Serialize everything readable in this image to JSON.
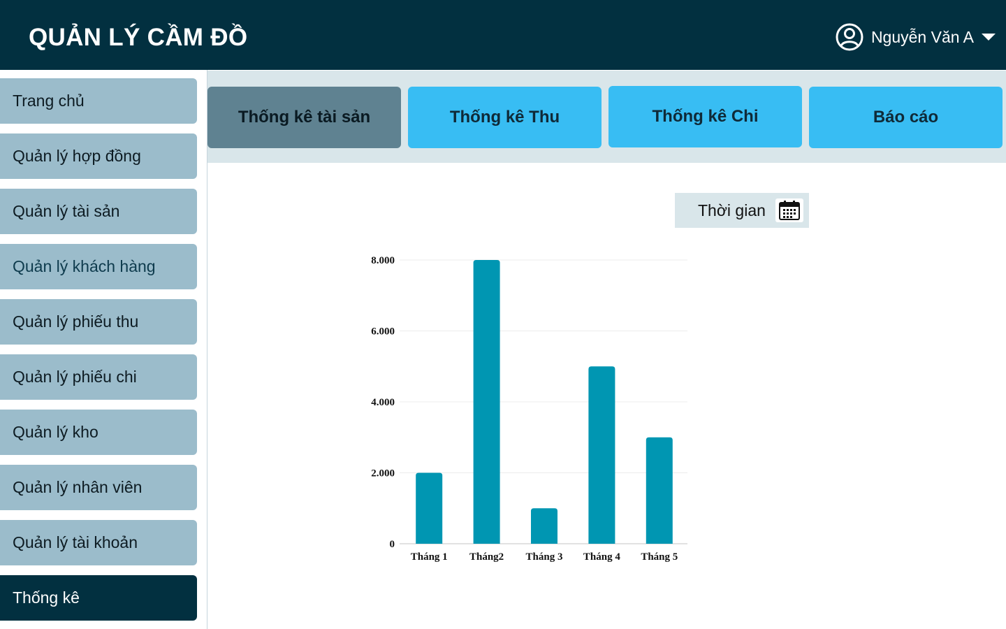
{
  "header": {
    "app_title": "QUẢN LÝ CẦM ĐỒ",
    "user_name": "Nguyễn Văn A",
    "user_icon": "user-circle-icon",
    "dropdown_icon": "caret-down-icon"
  },
  "sidebar": {
    "items": [
      {
        "label": "Trang chủ",
        "active": false
      },
      {
        "label": "Quản lý hợp đồng",
        "active": false
      },
      {
        "label": "Quản lý tài sản",
        "active": false
      },
      {
        "label": "Quản lý khách hàng",
        "active": false
      },
      {
        "label": "Quản lý phiếu thu",
        "active": false
      },
      {
        "label": "Quản lý phiếu chi",
        "active": false
      },
      {
        "label": "Quản lý kho",
        "active": false
      },
      {
        "label": "Quản lý nhân viên",
        "active": false
      },
      {
        "label": "Quản lý tài khoản",
        "active": false
      },
      {
        "label": "Thống kê",
        "active": true
      }
    ]
  },
  "tabs": [
    {
      "label": "Thống kê tài sản",
      "active": true
    },
    {
      "label": "Thống kê Thu",
      "active": false
    },
    {
      "label": "Thống kê Chi",
      "active": false
    },
    {
      "label": "Báo cáo",
      "active": false
    }
  ],
  "filter": {
    "time_label": "Thời gian",
    "icon": "calendar-icon"
  },
  "colors": {
    "header_bg": "#023040",
    "sidebar_item": "#9bbccb",
    "sidebar_active": "#023040",
    "tab": "#38bdf3",
    "tab_active": "#5f8291",
    "bar": "#0096b2"
  },
  "chart_data": {
    "type": "bar",
    "categories": [
      "Tháng 1",
      "Tháng2",
      "Tháng 3",
      "Tháng 4",
      "Tháng 5"
    ],
    "values": [
      2000,
      8000,
      1000,
      5000,
      3000
    ],
    "yticks": [
      "0",
      "2.000",
      "4.000",
      "6.000",
      "8.000"
    ],
    "ylim": [
      0,
      8000
    ],
    "grid": true
  }
}
